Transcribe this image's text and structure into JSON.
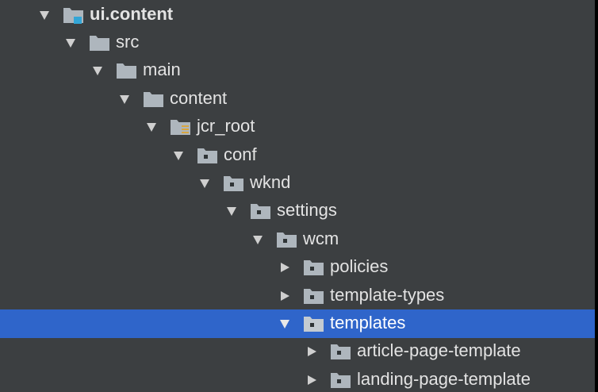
{
  "colors": {
    "background": "#3c3f41",
    "selection": "#2f65ca",
    "text": "#e3e3e3",
    "folder": "#aeb6bd",
    "module_badge": "#33a6d7",
    "resources_badge": "#d8a640",
    "package_dot": "#2f3436"
  },
  "tree": {
    "items": [
      {
        "label": "ui.content",
        "expanded": true,
        "icon": "module-folder-icon"
      },
      {
        "label": "src",
        "expanded": true,
        "icon": "folder-icon"
      },
      {
        "label": "main",
        "expanded": true,
        "icon": "folder-icon"
      },
      {
        "label": "content",
        "expanded": true,
        "icon": "folder-icon"
      },
      {
        "label": "jcr_root",
        "expanded": true,
        "icon": "resources-folder-icon"
      },
      {
        "label": "conf",
        "expanded": true,
        "icon": "package-folder-icon"
      },
      {
        "label": "wknd",
        "expanded": true,
        "icon": "package-folder-icon"
      },
      {
        "label": "settings",
        "expanded": true,
        "icon": "package-folder-icon"
      },
      {
        "label": "wcm",
        "expanded": true,
        "icon": "package-folder-icon"
      },
      {
        "label": "policies",
        "expanded": false,
        "icon": "package-folder-icon"
      },
      {
        "label": "template-types",
        "expanded": false,
        "icon": "package-folder-icon"
      },
      {
        "label": "templates",
        "expanded": true,
        "selected": true,
        "icon": "package-folder-icon"
      },
      {
        "label": "article-page-template",
        "expanded": false,
        "icon": "package-folder-icon"
      },
      {
        "label": "landing-page-template",
        "expanded": false,
        "icon": "package-folder-icon"
      }
    ]
  }
}
